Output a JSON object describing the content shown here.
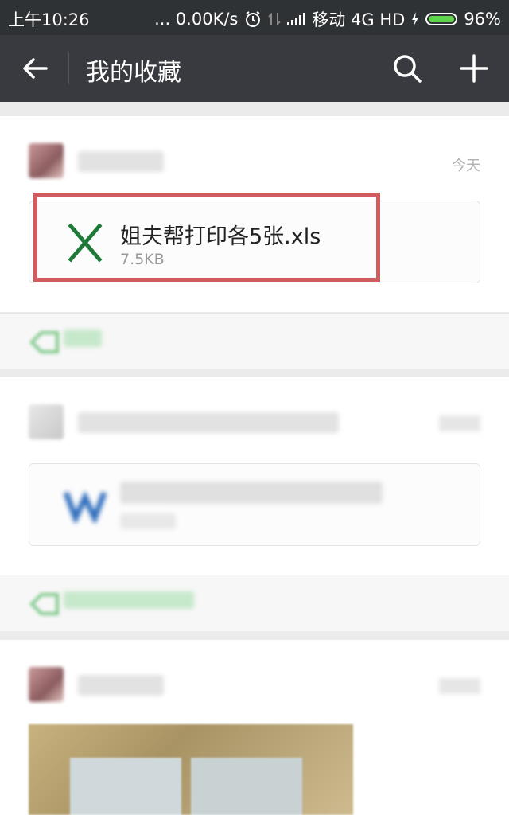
{
  "status_bar": {
    "time": "上午10:26",
    "network_speed": "... 0.00K/s",
    "carrier": "移动 4G HD",
    "battery": "96%"
  },
  "app_bar": {
    "title": "我的收藏",
    "back_icon": "arrow-left-icon",
    "search_icon": "search-icon",
    "add_icon": "plus-icon"
  },
  "favorites": [
    {
      "sender": "",
      "date": "今天",
      "file_name": "姐夫帮打印各5张.xls",
      "file_size": "7.5KB",
      "file_type": "excel",
      "tag": ""
    },
    {
      "sender": "",
      "date": "",
      "file_name": "",
      "file_size": "",
      "file_type": "word",
      "tag": ""
    },
    {
      "sender": "",
      "date": "",
      "file_type": "image"
    }
  ],
  "colors": {
    "status_bar": "#2e3235",
    "app_bar": "#393a3f",
    "excel_green": "#1f7a3a",
    "word_blue": "#2f6dbd",
    "highlight_red": "#cf5c5e",
    "tag_green": "#7fc98a"
  }
}
